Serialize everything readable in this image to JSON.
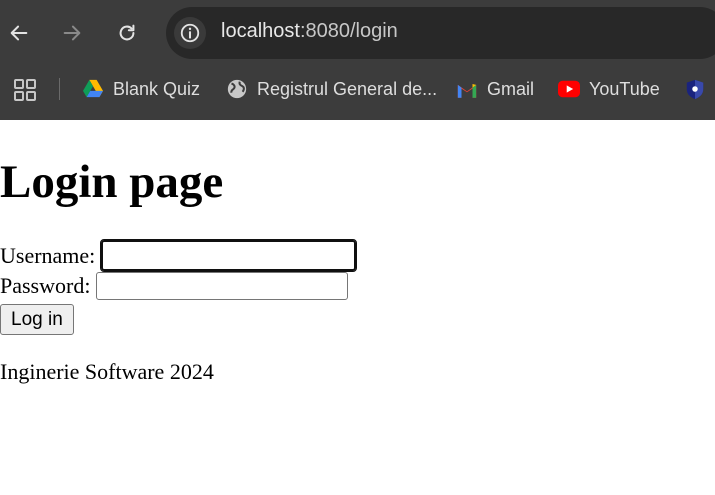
{
  "browser": {
    "url_host": "localhost",
    "url_path": ":8080/login",
    "colors": {
      "chrome_bg": "#3c3c3c",
      "omnibox_bg": "#282828",
      "text": "#e8e8e8"
    },
    "nav": {
      "back_icon": "arrow-left-icon",
      "forward_icon": "arrow-right-icon",
      "reload_icon": "reload-icon",
      "site_info_icon": "info-icon"
    },
    "bookmarks": [
      {
        "label": "Blank Quiz",
        "icon": "google-drive-icon"
      },
      {
        "label": "Registrul General de...",
        "icon": "globe-icon"
      },
      {
        "label": "Gmail",
        "icon": "gmail-icon"
      },
      {
        "label": "YouTube",
        "icon": "youtube-icon"
      },
      {
        "label": "",
        "icon": "shield-icon"
      }
    ]
  },
  "page": {
    "title": "Login page",
    "username_label": "Username:",
    "username_value": "",
    "password_label": "Password:",
    "password_value": "",
    "login_button": "Log in",
    "footer": "Inginerie Software 2024"
  }
}
